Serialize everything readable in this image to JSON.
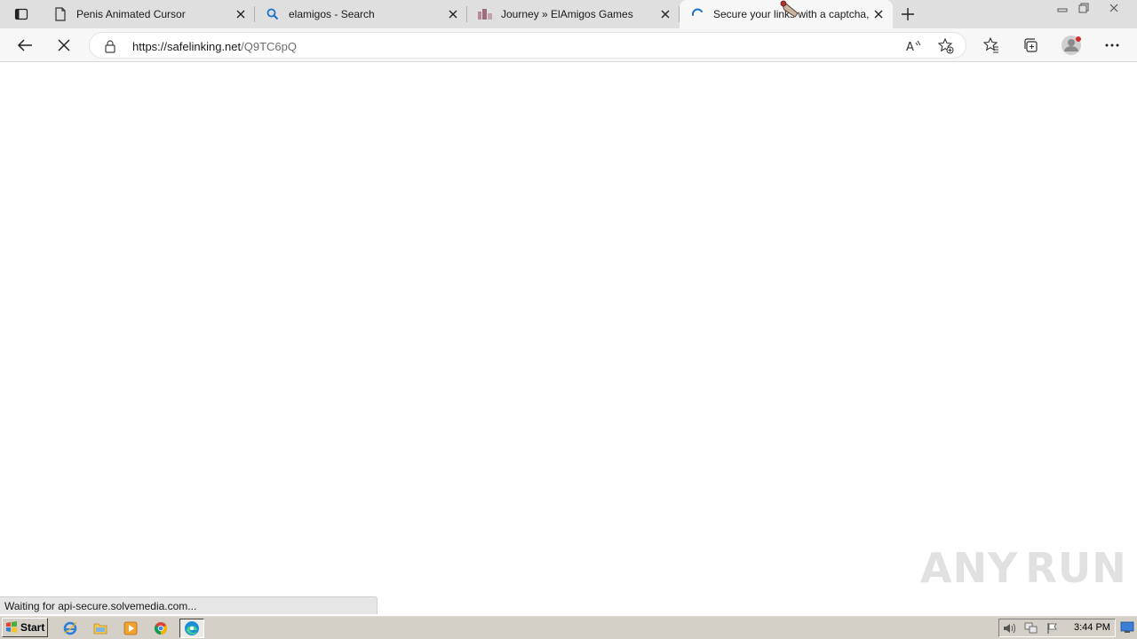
{
  "browser": {
    "tabs": [
      {
        "title": "Penis Animated Cursor",
        "icon": "page-icon",
        "state": "inactive"
      },
      {
        "title": "elamigos - Search",
        "icon": "search-icon",
        "state": "inactive"
      },
      {
        "title": "Journey » ElAmigos Games",
        "icon": "site-favicon",
        "state": "inactive"
      },
      {
        "title": "Secure your links with a captcha,",
        "icon": "loading-spinner-icon",
        "state": "active-loading"
      }
    ],
    "address": {
      "host": "https://safelinking.net",
      "path": "/Q9TC6pQ"
    },
    "status_text": "Waiting for api-secure.solvemedia.com..."
  },
  "watermark": {
    "left": "ANY",
    "right": "RUN"
  },
  "taskbar": {
    "start_label": "Start",
    "clock": "3:44 PM",
    "quick_launch": [
      "internet-explorer-icon",
      "file-explorer-icon",
      "media-player-icon",
      "chrome-icon",
      "edge-icon"
    ]
  },
  "colors": {
    "tabbar_bg": "#dfdfdf",
    "toolbar_bg": "#f7f7f7",
    "taskbar_bg": "#d4d0c8",
    "accent": "#0078d4"
  }
}
